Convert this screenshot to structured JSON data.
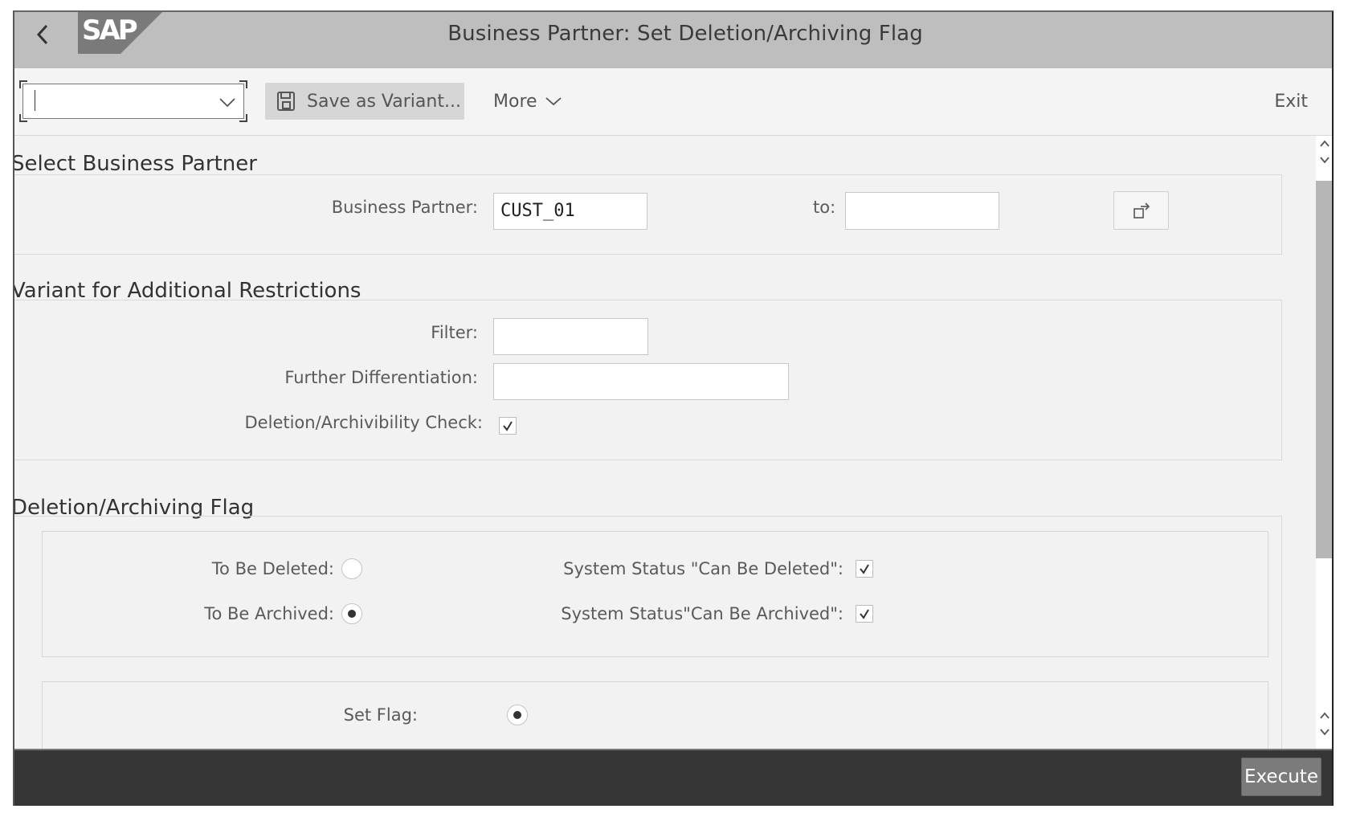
{
  "header": {
    "back_icon": "chevron-left-icon",
    "logo_text": "SAP",
    "title": "Business Partner: Set Deletion/Archiving Flag"
  },
  "toolbar": {
    "variant_value": "",
    "save_variant_label": "Save as Variant...",
    "save_variant_icon": "floppy-disk-icon",
    "more_label": "More",
    "exit_label": "Exit"
  },
  "sections": {
    "select_bp": {
      "title": "Select Business Partner",
      "bp_label": "Business Partner:",
      "bp_from_value": "CUST_01",
      "to_label": "to:",
      "bp_to_value": "",
      "multiselect_icon": "multiple-selection-icon"
    },
    "variant": {
      "title": "Variant for Additional Restrictions",
      "filter_label": "Filter:",
      "filter_value": "",
      "further_diff_label": "Further Differentiation:",
      "further_diff_value": "",
      "check_label": "Deletion/Archivibility Check:",
      "check_checked": true
    },
    "flag": {
      "title": "Deletion/Archiving Flag",
      "to_be_deleted_label": "To Be Deleted:",
      "to_be_deleted_selected": false,
      "to_be_archived_label": "To Be Archived:",
      "to_be_archived_selected": true,
      "sys_can_delete_label": "System Status \"Can Be Deleted\":",
      "sys_can_delete_checked": true,
      "sys_can_archive_label": "System Status\"Can Be Archived\":",
      "sys_can_archive_checked": true,
      "set_flag_label": "Set Flag:",
      "set_flag_selected": true
    }
  },
  "footer": {
    "execute_label": "Execute"
  },
  "colors": {
    "header_bg": "#bebebe",
    "toolbar_bg": "#f4f4f4",
    "content_bg": "#f2f2f2",
    "footer_bg": "#363636",
    "execute_bg": "#7b7b7b"
  }
}
